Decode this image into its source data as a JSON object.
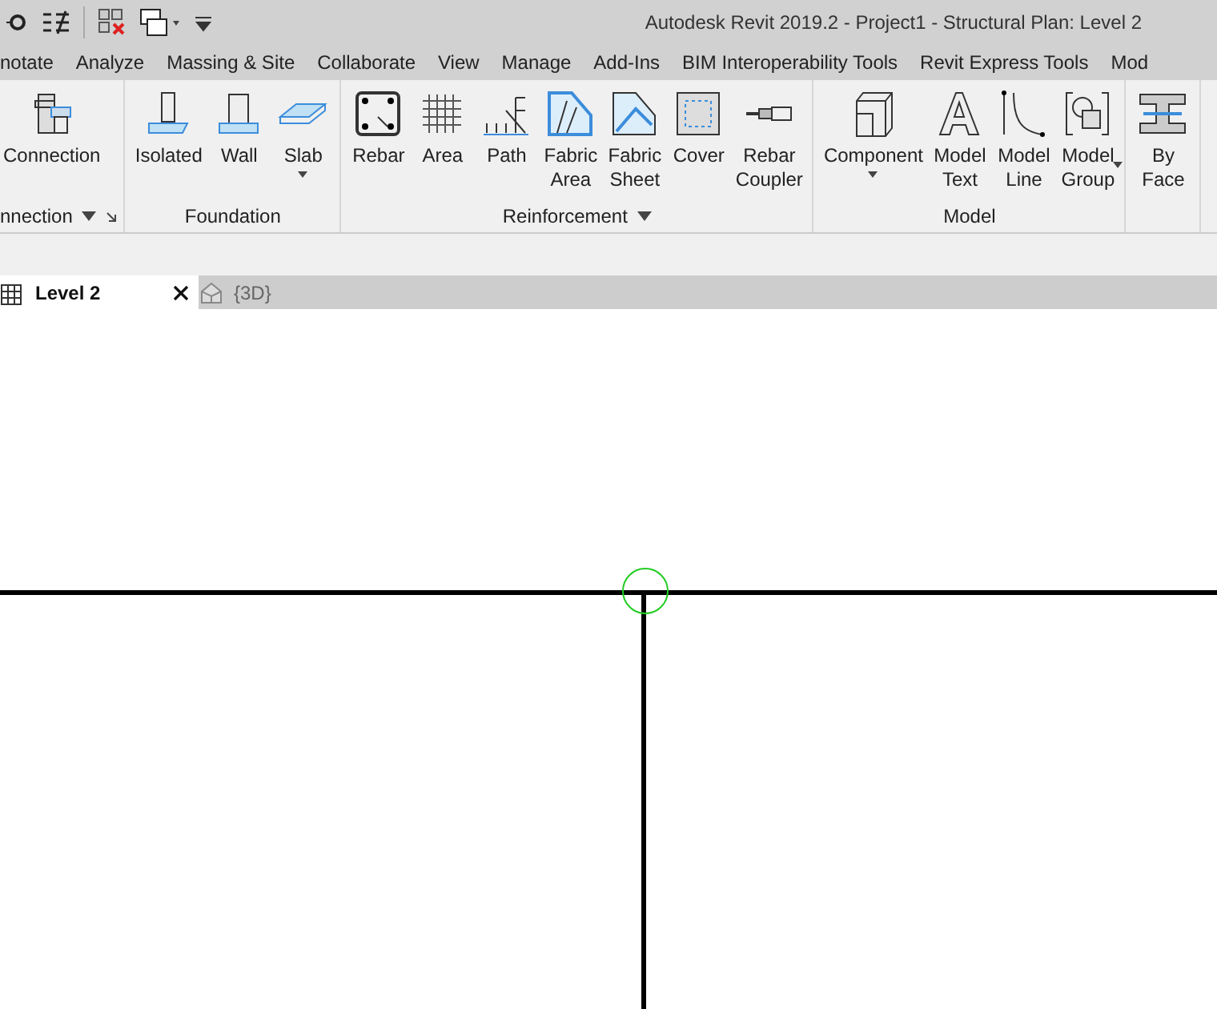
{
  "window": {
    "title": "Autodesk Revit 2019.2 - Project1 - Structural Plan: Level 2"
  },
  "menu_tabs": [
    "notate",
    "Analyze",
    "Massing & Site",
    "Collaborate",
    "View",
    "Manage",
    "Add-Ins",
    "BIM Interoperability Tools",
    "Revit Express Tools",
    "Mod"
  ],
  "ribbon": {
    "panels": [
      {
        "label": "nnection",
        "dropdown": true,
        "launcher": true,
        "buttons": [
          {
            "label": "Connection",
            "kind": "connection"
          }
        ]
      },
      {
        "label": "Foundation",
        "buttons": [
          {
            "label": "Isolated",
            "kind": "isolated"
          },
          {
            "label": "Wall",
            "kind": "wall"
          },
          {
            "label": "Slab",
            "kind": "slab",
            "dropdown": true
          }
        ]
      },
      {
        "label": "Reinforcement",
        "dropdown": true,
        "buttons": [
          {
            "label": "Rebar",
            "kind": "rebar"
          },
          {
            "label": "Area",
            "kind": "area"
          },
          {
            "label": "Path",
            "kind": "path"
          },
          {
            "label": "Fabric\nArea",
            "kind": "fabricarea"
          },
          {
            "label": "Fabric\nSheet",
            "kind": "fabricsheet"
          },
          {
            "label": "Cover",
            "kind": "cover"
          },
          {
            "label": "Rebar\nCoupler",
            "kind": "coupler"
          }
        ]
      },
      {
        "label": "Model",
        "buttons": [
          {
            "label": "Component",
            "kind": "component",
            "dropdown": true
          },
          {
            "label": "Model\nText",
            "kind": "text"
          },
          {
            "label": "Model\nLine",
            "kind": "line"
          },
          {
            "label": "Model\nGroup",
            "kind": "group",
            "dropdown_side": true
          }
        ]
      },
      {
        "buttons": [
          {
            "label": "By\nFace",
            "kind": "byface"
          }
        ]
      }
    ]
  },
  "doc_tabs": [
    {
      "label": "Level 2",
      "kind": "plan",
      "selected": true
    },
    {
      "label": "{3D}",
      "kind": "model",
      "selected": false
    }
  ]
}
